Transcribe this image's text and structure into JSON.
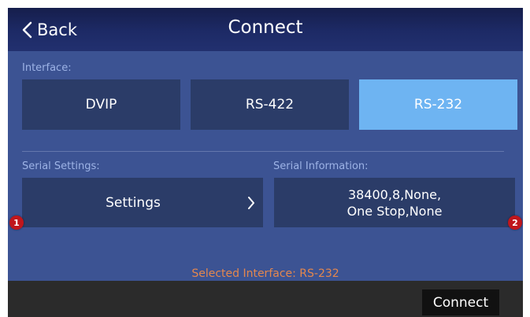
{
  "header": {
    "back_label": "Back",
    "title": "Connect"
  },
  "interface": {
    "label": "Interface:",
    "options": [
      "DVIP",
      "RS-422",
      "RS-232"
    ],
    "selected": "RS-232"
  },
  "serial_settings": {
    "label": "Serial Settings:",
    "button_label": "Settings"
  },
  "serial_information": {
    "label": "Serial Information:",
    "line1": "38400,8,None,",
    "line2": "One Stop,None"
  },
  "status": {
    "selected_interface_text": "Selected Interface: RS-232"
  },
  "markers": [
    "1",
    "2"
  ],
  "footer": {
    "connect_label": "Connect"
  },
  "colors": {
    "header_dark": "#161e4c",
    "panel_background": "#3c5393",
    "button_background": "#2b3c68",
    "selected_button": "#6eb4f2",
    "label_text": "#9db3e6",
    "status_text": "#e4874e",
    "marker_red": "#c0161c",
    "footer_background": "#2b2b2b"
  },
  "icons": {
    "back": "chevron-left-icon",
    "settings": "chevron-right-icon"
  }
}
